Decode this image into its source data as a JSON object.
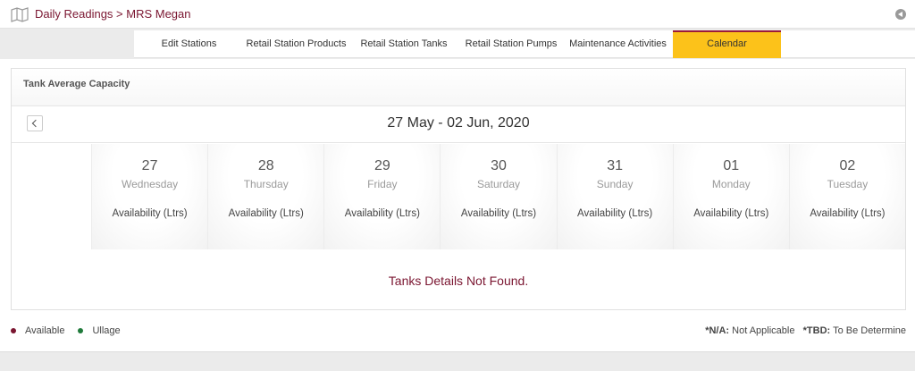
{
  "header": {
    "breadcrumb": "Daily Readings > MRS Megan",
    "map_icon": "map-icon",
    "back_icon": "back-arrow-icon"
  },
  "tabs": [
    {
      "label": "Edit Stations",
      "active": false
    },
    {
      "label": "Retail Station Products",
      "active": false
    },
    {
      "label": "Retail Station Tanks",
      "active": false
    },
    {
      "label": "Retail Station Pumps",
      "active": false
    },
    {
      "label": "Maintenance Activities",
      "active": false
    },
    {
      "label": "Calendar",
      "active": true
    }
  ],
  "panel": {
    "title": "Tank Average Capacity",
    "date_range": "27 May - 02 Jun, 2020",
    "prev_icon": "chevron-left-icon",
    "days": [
      {
        "num": "27",
        "name": "Wednesday",
        "availability": "Availability (Ltrs)"
      },
      {
        "num": "28",
        "name": "Thursday",
        "availability": "Availability (Ltrs)"
      },
      {
        "num": "29",
        "name": "Friday",
        "availability": "Availability (Ltrs)"
      },
      {
        "num": "30",
        "name": "Saturday",
        "availability": "Availability (Ltrs)"
      },
      {
        "num": "31",
        "name": "Sunday",
        "availability": "Availability (Ltrs)"
      },
      {
        "num": "01",
        "name": "Monday",
        "availability": "Availability (Ltrs)"
      },
      {
        "num": "02",
        "name": "Tuesday",
        "availability": "Availability (Ltrs)"
      }
    ],
    "empty_message": "Tanks Details Not Found."
  },
  "legend": [
    {
      "label": "Available",
      "color": "#7a1530"
    },
    {
      "label": "Ullage",
      "color": "#1f7a3a"
    }
  ],
  "notes": {
    "na_key": "*N/A:",
    "na_value": "Not Applicable",
    "tbd_key": "*TBD:",
    "tbd_value": "To Be Determine"
  },
  "colors": {
    "accent": "#7a1530",
    "active_tab": "#fcc21a",
    "active_tab_border": "#9b1b3a"
  }
}
